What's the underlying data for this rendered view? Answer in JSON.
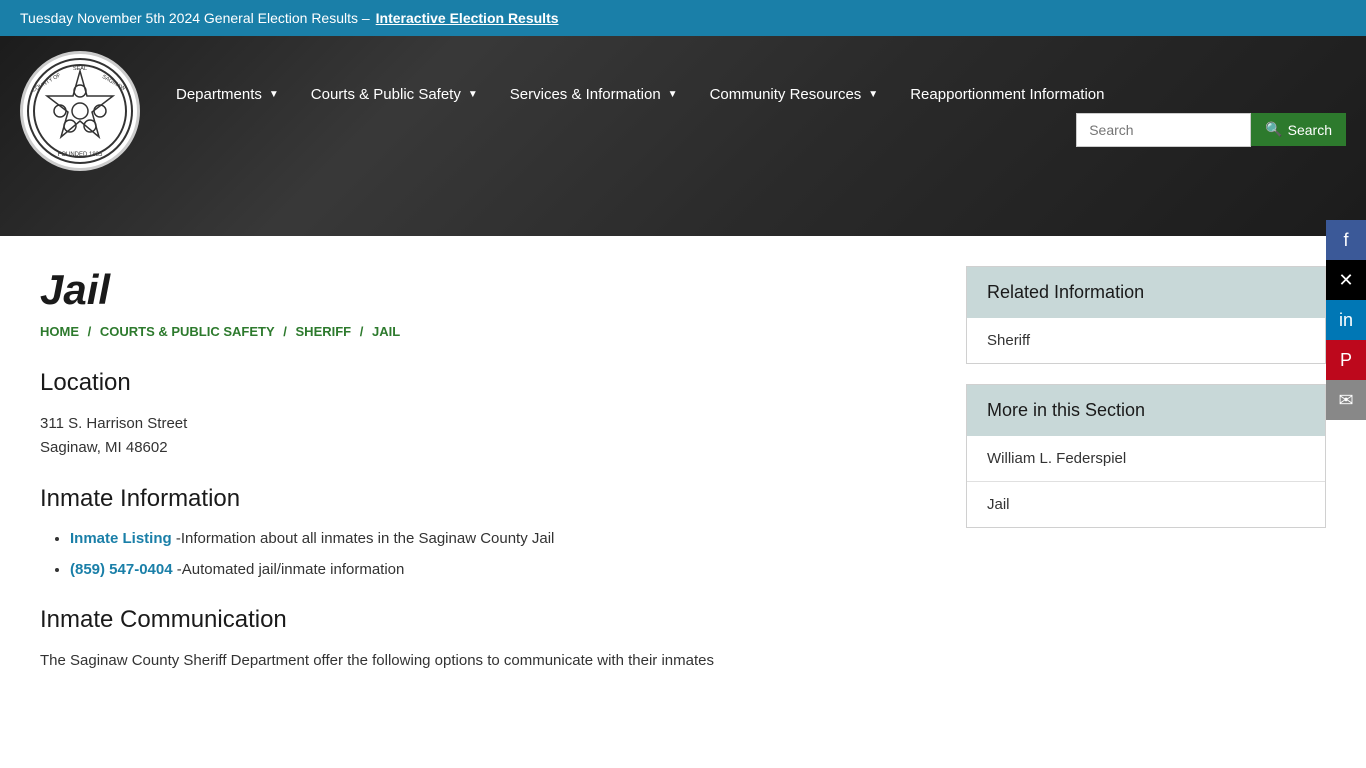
{
  "announcement": {
    "text": "Tuesday November 5th 2024 General Election Results  – ",
    "link_text": "Interactive Election Results",
    "link_href": "#"
  },
  "nav": {
    "departments_label": "Departments",
    "courts_label": "Courts & Public Safety",
    "services_label": "Services & Information",
    "community_label": "Community Resources",
    "reapportionment_label": "Reapportionment Information",
    "search_placeholder": "Search",
    "search_btn_label": "Search"
  },
  "breadcrumb": {
    "home": "HOME",
    "courts": "COURTS & PUBLIC SAFETY",
    "sheriff": "SHERIFF",
    "current": "JAIL"
  },
  "page": {
    "title": "Jail",
    "location_heading": "Location",
    "address_line1": "311 S. Harrison Street",
    "address_line2": "Saginaw, MI 48602",
    "inmate_info_heading": "Inmate Information",
    "inmate_listing_link": "Inmate Listing",
    "inmate_listing_desc": " -Information about all inmates in the Saginaw County Jail",
    "phone_link": "(859) 547-0404",
    "phone_desc": " -Automated jail/inmate information",
    "inmate_communication_heading": "Inmate Communication",
    "communication_text": "The Saginaw County Sheriff Department offer the following options to communicate with their inmates"
  },
  "sidebar": {
    "related_info_heading": "Related Information",
    "related_items": [
      {
        "label": "Sheriff",
        "href": "#"
      }
    ],
    "more_section_heading": "More in this Section",
    "more_items": [
      {
        "label": "William L. Federspiel",
        "href": "#"
      },
      {
        "label": "Jail",
        "href": "#"
      }
    ]
  },
  "social": {
    "facebook": "f",
    "twitter": "✕",
    "linkedin": "in",
    "pinterest": "P",
    "email": "✉"
  }
}
